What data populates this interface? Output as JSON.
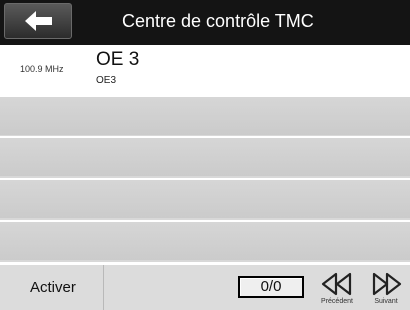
{
  "header": {
    "title": "Centre de contrôle TMC",
    "back_icon": "back-arrow-icon"
  },
  "station": {
    "frequency": "100.9 MHz",
    "name": "OE 3",
    "sub_name": "OE3"
  },
  "list": {
    "empty_rows": 4
  },
  "toolbar": {
    "activate_label": "Activer",
    "counter": "0/0",
    "prev_label": "Précédent",
    "next_label": "Suivant",
    "prev_icon": "rewind-icon",
    "next_icon": "fast-forward-icon"
  }
}
